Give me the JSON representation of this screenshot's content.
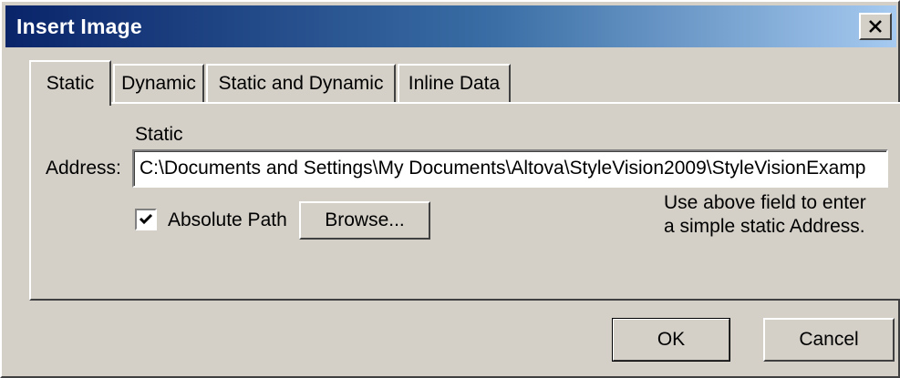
{
  "window": {
    "title": "Insert Image"
  },
  "tabs": [
    {
      "label": "Static",
      "active": true
    },
    {
      "label": "Dynamic",
      "active": false
    },
    {
      "label": "Static and Dynamic",
      "active": false
    },
    {
      "label": "Inline Data",
      "active": false
    }
  ],
  "static_panel": {
    "group_label": "Static",
    "address_label": "Address:",
    "address_value": "C:\\Documents and Settings\\My Documents\\Altova\\StyleVision2009\\StyleVisionExamp",
    "absolute_path_label": "Absolute Path",
    "absolute_path_checked": true,
    "browse_label": "Browse...",
    "hint_line1": "Use above field to enter",
    "hint_line2": "a simple static Address."
  },
  "footer": {
    "ok_label": "OK",
    "cancel_label": "Cancel"
  },
  "colors": {
    "face": "#d4d0c8",
    "title_start": "#0a246a",
    "title_end": "#a6caf0"
  }
}
